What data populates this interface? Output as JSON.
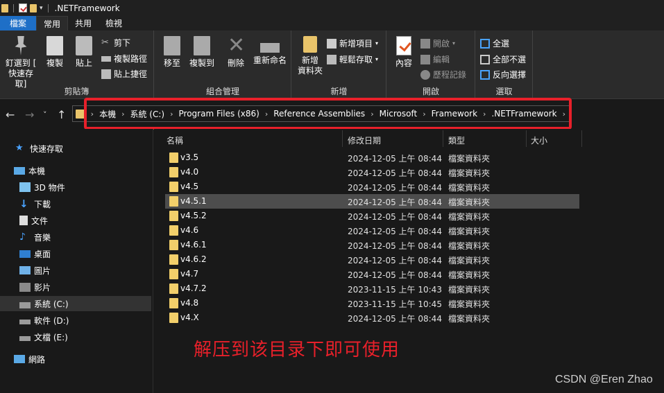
{
  "window": {
    "title": ".NETFramework"
  },
  "tabs": [
    "檔案",
    "常用",
    "共用",
    "檢視"
  ],
  "ribbon": {
    "clipboard": {
      "label": "剪貼簿",
      "pin": "釘選到 [\n快速存取]",
      "copy": "複製",
      "paste": "貼上",
      "cut": "剪下",
      "copy_path": "複製路徑",
      "paste_shortcut": "貼上捷徑"
    },
    "organize": {
      "label": "組合管理",
      "move_to": "移至",
      "copy_to": "複製到",
      "delete": "刪除",
      "rename": "重新命名"
    },
    "new": {
      "label": "新增",
      "new_folder": "新增\n資料夾",
      "new_item": "新增項目",
      "easy_access": "輕鬆存取"
    },
    "open": {
      "label": "開啟",
      "properties": "內容",
      "open": "開啟",
      "edit": "編輯",
      "history": "歷程記錄"
    },
    "select": {
      "label": "選取",
      "select_all": "全選",
      "select_none": "全部不選",
      "invert": "反向選擇"
    }
  },
  "address": {
    "crumbs": [
      "本機",
      "系統 (C:)",
      "Program Files (x86)",
      "Reference Assemblies",
      "Microsoft",
      "Framework",
      ".NETFramework"
    ]
  },
  "sidebar": {
    "items": [
      {
        "label": "快速存取",
        "icon": "star-icon"
      },
      {
        "label": "本機",
        "icon": "computer-icon"
      },
      {
        "label": "3D 物件",
        "icon": "cube-icon"
      },
      {
        "label": "下載",
        "icon": "download-icon"
      },
      {
        "label": "文件",
        "icon": "document-icon"
      },
      {
        "label": "音樂",
        "icon": "music-icon"
      },
      {
        "label": "桌面",
        "icon": "desktop-icon"
      },
      {
        "label": "圖片",
        "icon": "picture-icon"
      },
      {
        "label": "影片",
        "icon": "video-icon"
      },
      {
        "label": "系統 (C:)",
        "icon": "drive-icon"
      },
      {
        "label": "軟件 (D:)",
        "icon": "drive-icon"
      },
      {
        "label": "文檔 (E:)",
        "icon": "drive-icon"
      },
      {
        "label": "網路",
        "icon": "network-icon"
      }
    ]
  },
  "columns": {
    "name": "名稱",
    "date": "修改日期",
    "type": "類型",
    "size": "大小"
  },
  "files": [
    {
      "name": "v3.5",
      "date": "2024-12-05 上午 08:44",
      "type": "檔案資料夾"
    },
    {
      "name": "v4.0",
      "date": "2024-12-05 上午 08:44",
      "type": "檔案資料夾"
    },
    {
      "name": "v4.5",
      "date": "2024-12-05 上午 08:44",
      "type": "檔案資料夾"
    },
    {
      "name": "v4.5.1",
      "date": "2024-12-05 上午 08:44",
      "type": "檔案資料夾"
    },
    {
      "name": "v4.5.2",
      "date": "2024-12-05 上午 08:44",
      "type": "檔案資料夾"
    },
    {
      "name": "v4.6",
      "date": "2024-12-05 上午 08:44",
      "type": "檔案資料夾"
    },
    {
      "name": "v4.6.1",
      "date": "2024-12-05 上午 08:44",
      "type": "檔案資料夾"
    },
    {
      "name": "v4.6.2",
      "date": "2024-12-05 上午 08:44",
      "type": "檔案資料夾"
    },
    {
      "name": "v4.7",
      "date": "2024-12-05 上午 08:44",
      "type": "檔案資料夾"
    },
    {
      "name": "v4.7.2",
      "date": "2023-11-15 上午 10:43",
      "type": "檔案資料夾"
    },
    {
      "name": "v4.8",
      "date": "2023-11-15 上午 10:45",
      "type": "檔案資料夾"
    },
    {
      "name": "v4.X",
      "date": "2024-12-05 上午 08:44",
      "type": "檔案資料夾"
    }
  ],
  "annotation": "解压到该目录下即可使用",
  "watermark": "CSDN @Eren Zhao"
}
